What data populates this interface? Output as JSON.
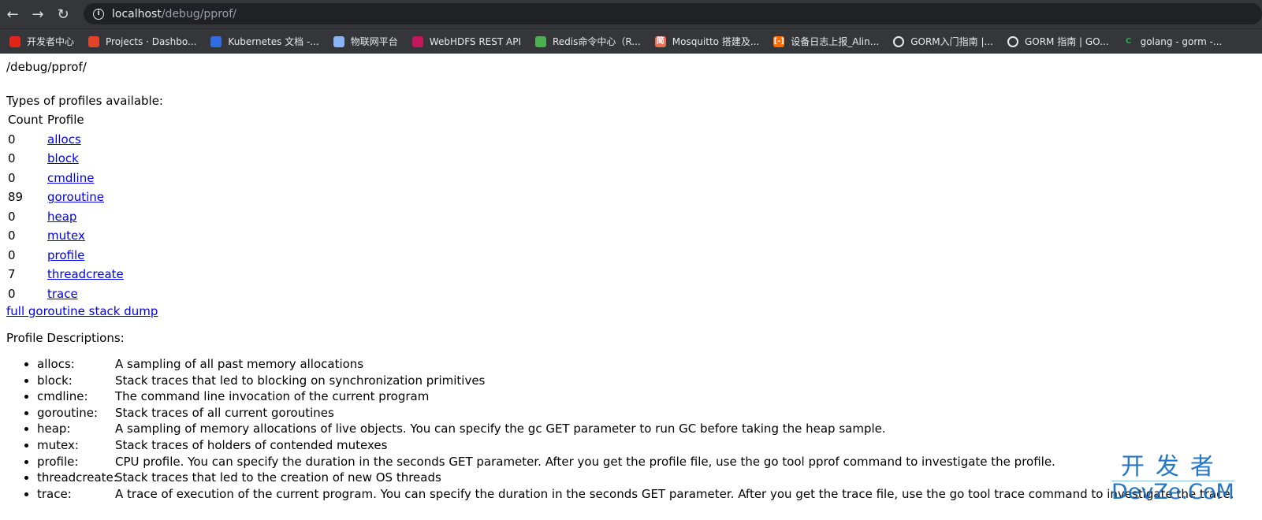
{
  "browser": {
    "address_host": "localhost",
    "address_path": "/debug/pprof/",
    "bookmarks": [
      {
        "label": "开发者中心",
        "icon": "aliyun-icon",
        "color": "#e1251b"
      },
      {
        "label": "Projects · Dashbo...",
        "icon": "gitlab-icon",
        "color": "#e24329"
      },
      {
        "label": "Kubernetes 文档 -...",
        "icon": "kubernetes-icon",
        "color": "#326ce5"
      },
      {
        "label": "物联网平台",
        "icon": "cloud-icon",
        "color": "#8ab4f8"
      },
      {
        "label": "WebHDFS REST API",
        "icon": "feather-icon",
        "color": "#c2185b"
      },
      {
        "label": "Redis命令中心（R...",
        "icon": "redis-stack-icon",
        "color": "#4caf50"
      },
      {
        "label": "Mosquitto 搭建及...",
        "icon": "jianshu-icon",
        "color": "#ea6f5a",
        "glyph": "简"
      },
      {
        "label": "设备日志上报_Alin...",
        "icon": "aliyun-bracket-icon",
        "color": "#ff6a00",
        "glyph": "[-]"
      },
      {
        "label": "GORM入门指南 |...",
        "icon": "globe-icon",
        "color": "#e8eaed"
      },
      {
        "label": "GORM 指南 | GO...",
        "icon": "globe-icon",
        "color": "#e8eaed"
      },
      {
        "label": "golang - gorm -...",
        "icon": "c-logo-icon",
        "color": "#2ea44f",
        "glyph": "C"
      }
    ]
  },
  "page": {
    "title": "/debug/pprof/",
    "types_heading": "Types of profiles available:",
    "table_headers": [
      "Count",
      "Profile"
    ],
    "profiles": [
      {
        "count": "0",
        "name": "allocs"
      },
      {
        "count": "0",
        "name": "block"
      },
      {
        "count": "0",
        "name": "cmdline"
      },
      {
        "count": "89",
        "name": "goroutine"
      },
      {
        "count": "0",
        "name": "heap"
      },
      {
        "count": "0",
        "name": "mutex"
      },
      {
        "count": "0",
        "name": "profile"
      },
      {
        "count": "7",
        "name": "threadcreate"
      },
      {
        "count": "0",
        "name": "trace"
      }
    ],
    "full_dump_link": "full goroutine stack dump",
    "descriptions_heading": "Profile Descriptions:",
    "descriptions": [
      {
        "name": "allocs:",
        "text": "A sampling of all past memory allocations"
      },
      {
        "name": "block:",
        "text": "Stack traces that led to blocking on synchronization primitives"
      },
      {
        "name": "cmdline:",
        "text": "The command line invocation of the current program"
      },
      {
        "name": "goroutine:",
        "text": "Stack traces of all current goroutines"
      },
      {
        "name": "heap:",
        "text": "A sampling of memory allocations of live objects. You can specify the gc GET parameter to run GC before taking the heap sample."
      },
      {
        "name": "mutex:",
        "text": "Stack traces of holders of contended mutexes"
      },
      {
        "name": "profile:",
        "text": "CPU profile. You can specify the duration in the seconds GET parameter. After you get the profile file, use the go tool pprof command to investigate the profile."
      },
      {
        "name": "threadcreate:",
        "text": "Stack traces that led to the creation of new OS threads"
      },
      {
        "name": "trace:",
        "text": "A trace of execution of the current program. You can specify the duration in the seconds GET parameter. After you get the trace file, use the go tool trace command to investigate the trace."
      }
    ]
  },
  "watermark": {
    "cn": "开发者",
    "en": "DevZe.CoM"
  }
}
